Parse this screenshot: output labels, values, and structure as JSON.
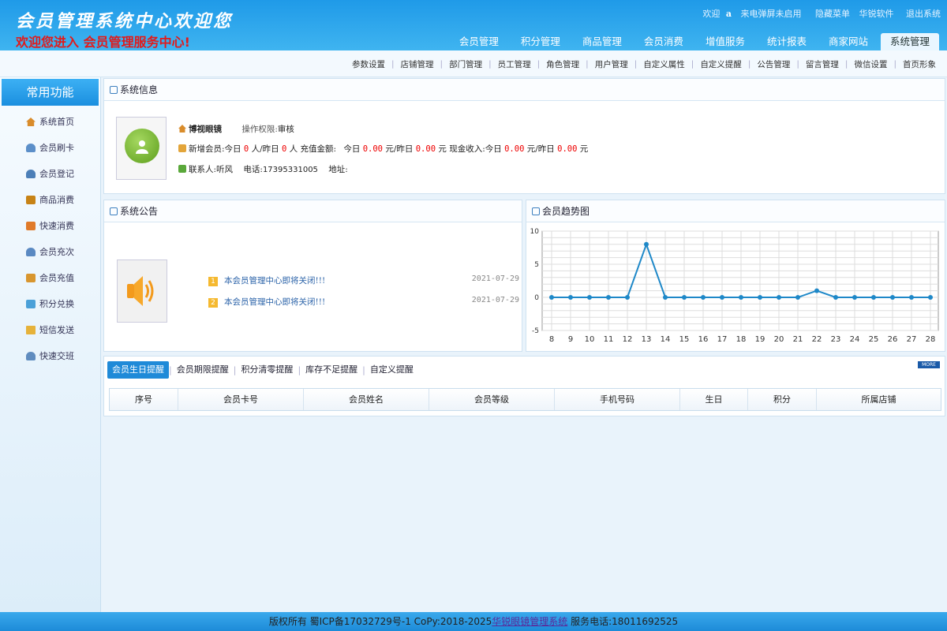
{
  "header": {
    "title": "会员管理系统中心欢迎您",
    "subtitle": "欢迎您进入 会员管理服务中心!",
    "welcome": "欢迎",
    "user": "a",
    "links": [
      "来电弹屏未启用",
      "隐藏菜单",
      "华锐软件",
      "退出系统"
    ]
  },
  "main_nav": [
    "会员管理",
    "积分管理",
    "商品管理",
    "会员消费",
    "增值服务",
    "统计报表",
    "商家网站",
    "系统管理"
  ],
  "active_nav": "系统管理",
  "sub_nav": [
    "参数设置",
    "店铺管理",
    "部门管理",
    "员工管理",
    "角色管理",
    "用户管理",
    "自定义属性",
    "自定义提醒",
    "公告管理",
    "留言管理",
    "微信设置",
    "首页形象"
  ],
  "sidebar": {
    "title": "常用功能",
    "items": [
      {
        "label": "系统首页",
        "icon": "home-icon"
      },
      {
        "label": "会员刷卡",
        "icon": "user-card-icon"
      },
      {
        "label": "会员登记",
        "icon": "user-add-icon"
      },
      {
        "label": "商品消费",
        "icon": "cart-icon"
      },
      {
        "label": "快速消费",
        "icon": "fast-icon"
      },
      {
        "label": "会员充次",
        "icon": "recharge-icon"
      },
      {
        "label": "会员充值",
        "icon": "money-icon"
      },
      {
        "label": "积分兑换",
        "icon": "gift-icon"
      },
      {
        "label": "短信发送",
        "icon": "mail-icon"
      },
      {
        "label": "快速交班",
        "icon": "shift-icon"
      }
    ]
  },
  "system_info": {
    "title": "系统信息",
    "shop_name": "博视眼镜",
    "permission_label": "操作权限:",
    "permission_value": "审核",
    "new_member_label": "新增会员:",
    "today_label": "今日",
    "new_today": "0",
    "person_unit": "人",
    "yesterday_label": "/昨日",
    "new_yesterday": "0",
    "recharge_label": "充值金额:",
    "recharge_today": "0.00",
    "recharge_yesterday": "0.00",
    "yuan": "元",
    "cash_label": "现金收入:",
    "cash_today": "0.00",
    "cash_yesterday": "0.00",
    "contact_label": "联系人:",
    "contact": "听风",
    "phone_label": "电话:",
    "phone": "17395331005",
    "address_label": "地址:"
  },
  "notice": {
    "title": "系统公告",
    "items": [
      {
        "num": "1",
        "text": "本会员管理中心即将关闭!!!",
        "date": "2021-07-29"
      },
      {
        "num": "2",
        "text": "本会员管理中心即将关闭!!!",
        "date": "2021-07-29"
      }
    ]
  },
  "trend": {
    "title": "会员趋势图"
  },
  "chart_data": {
    "type": "line",
    "title": "",
    "xlabel": "",
    "ylabel": "",
    "x": [
      8,
      9,
      10,
      11,
      12,
      13,
      14,
      15,
      16,
      17,
      18,
      19,
      20,
      21,
      22,
      23,
      24,
      25,
      26,
      27,
      28
    ],
    "series": [
      {
        "values": [
          0,
          0,
          0,
          0,
          0,
          8,
          0,
          0,
          0,
          0,
          0,
          0,
          0,
          0,
          1,
          0,
          0,
          0,
          0,
          0,
          0
        ]
      }
    ],
    "ylim": [
      -5,
      10
    ],
    "yticks": [
      10,
      5,
      0,
      -5
    ],
    "grid": true,
    "color": "#1e88c8"
  },
  "reminder": {
    "tabs": [
      "会员生日提醒",
      "会员期限提醒",
      "积分清零提醒",
      "库存不足提醒",
      "自定义提醒"
    ],
    "more": "MORE",
    "columns": [
      "序号",
      "会员卡号",
      "会员姓名",
      "会员等级",
      "手机号码",
      "生日",
      "积分",
      "所属店铺"
    ]
  },
  "footer": {
    "text_before": "版权所有 蜀ICP备17032729号-1 CoPy:2018-2025",
    "link": "华锐眼镜管理系统",
    "text_after": " 服务电话:18011692525"
  },
  "colors": {
    "primary": "#1f8ad8",
    "header_bg": "#3fb4f0",
    "accent_red": "#e21a1a"
  }
}
